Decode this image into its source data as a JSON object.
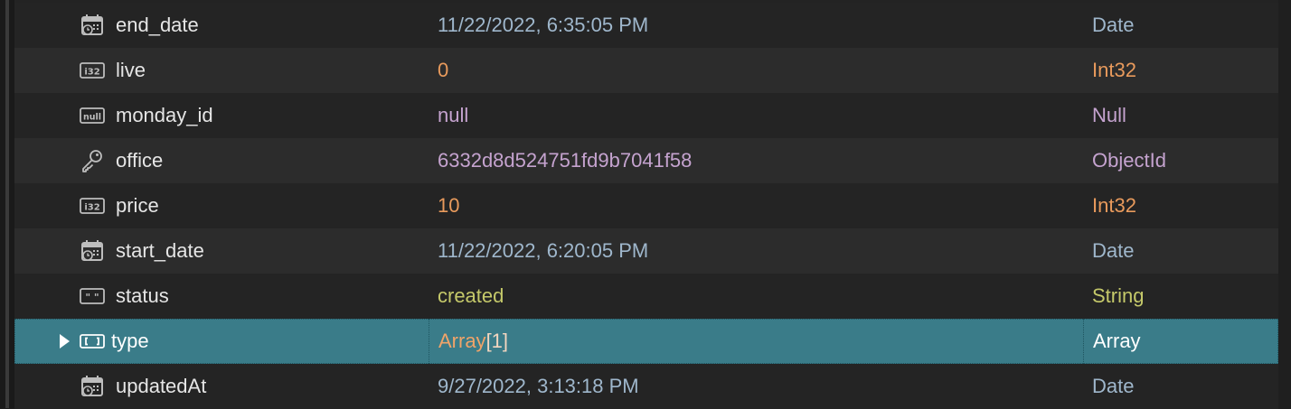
{
  "rows": [
    {
      "key": "end_date",
      "value": "11/22/2022, 6:35:05 PM",
      "type": "Date",
      "icon": "calendar-icon"
    },
    {
      "key": "live",
      "value": "0",
      "type": "Int32",
      "icon": "int32-icon"
    },
    {
      "key": "monday_id",
      "value": "null",
      "type": "Null",
      "icon": "null-icon"
    },
    {
      "key": "office",
      "value": "6332d8d524751fd9b7041f58",
      "type": "ObjectId",
      "icon": "key-icon"
    },
    {
      "key": "price",
      "value": "10",
      "type": "Int32",
      "icon": "int32-icon"
    },
    {
      "key": "start_date",
      "value": "11/22/2022, 6:20:05 PM",
      "type": "Date",
      "icon": "calendar-icon"
    },
    {
      "key": "status",
      "value": "created",
      "type": "String",
      "icon": "string-icon"
    },
    {
      "key": "type",
      "value_prefix": "Array",
      "value_count": "[1]",
      "type": "Array",
      "icon": "array-icon",
      "selected": true
    },
    {
      "key": "updatedAt",
      "value": "9/27/2022, 3:13:18 PM",
      "type": "Date",
      "icon": "calendar-icon"
    }
  ],
  "icon_glyphs": {
    "int32": "i32",
    "null": "null",
    "string": "\" \""
  }
}
